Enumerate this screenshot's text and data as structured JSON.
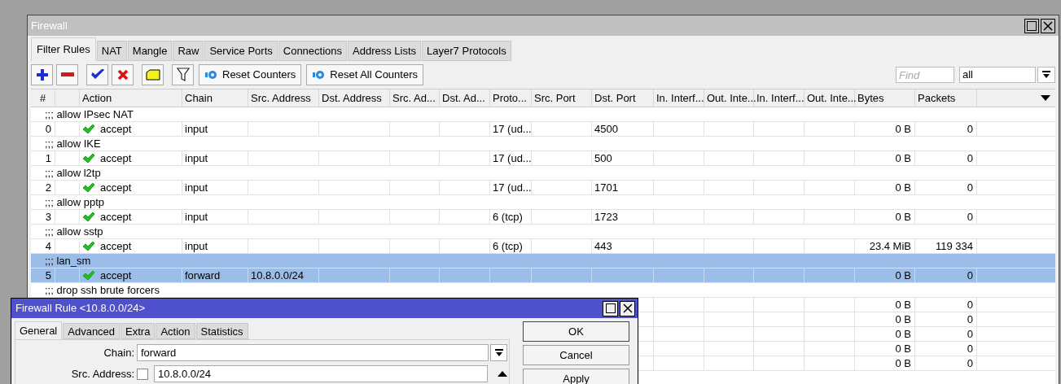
{
  "window": {
    "title": "Firewall"
  },
  "tabs": [
    {
      "label": "Filter Rules",
      "selected": true
    },
    {
      "label": "NAT",
      "selected": false
    },
    {
      "label": "Mangle",
      "selected": false
    },
    {
      "label": "Raw",
      "selected": false
    },
    {
      "label": "Service Ports",
      "selected": false
    },
    {
      "label": "Connections",
      "selected": false
    },
    {
      "label": "Address Lists",
      "selected": false
    },
    {
      "label": "Layer7 Protocols",
      "selected": false
    }
  ],
  "toolbar": {
    "icon_buttons": [
      {
        "kind": "add"
      },
      {
        "kind": "remove"
      },
      {
        "kind": "enable"
      },
      {
        "kind": "disable"
      },
      {
        "kind": "comment"
      },
      {
        "kind": "filter"
      }
    ],
    "text_buttons": [
      "Reset Counters",
      "Reset All Counters"
    ],
    "find": {
      "placeholder": "Find"
    },
    "filter_select": {
      "value": "all"
    }
  },
  "table": {
    "columns": [
      "#",
      "Action",
      "Chain",
      "Src. Address",
      "Dst. Address",
      "Src. Ad...",
      "Dst. Ad...",
      "Proto...",
      "Src. Port",
      "Dst. Port",
      "In. Interf...",
      "Out. Inte...",
      "In. Interf...",
      "Out. Inte...",
      "Bytes",
      "Packets"
    ],
    "rows": [
      {
        "kind": "comment",
        "text": ";;; allow IPsec NAT",
        "selected": false
      },
      {
        "kind": "rule",
        "number": "0",
        "action": "accept",
        "chain": "input",
        "protocol": "17 (ud...",
        "dst_port": "4500",
        "bytes": "0 B",
        "packets": "0",
        "selected": false
      },
      {
        "kind": "comment",
        "text": ";;; allow IKE",
        "selected": false
      },
      {
        "kind": "rule",
        "number": "1",
        "action": "accept",
        "chain": "input",
        "protocol": "17 (ud...",
        "dst_port": "500",
        "bytes": "0 B",
        "packets": "0",
        "selected": false
      },
      {
        "kind": "comment",
        "text": ";;; allow l2tp",
        "selected": false
      },
      {
        "kind": "rule",
        "number": "2",
        "action": "accept",
        "chain": "input",
        "protocol": "17 (ud...",
        "dst_port": "1701",
        "bytes": "0 B",
        "packets": "0",
        "selected": false
      },
      {
        "kind": "comment",
        "text": ";;; allow pptp",
        "selected": false
      },
      {
        "kind": "rule",
        "number": "3",
        "action": "accept",
        "chain": "input",
        "protocol": "6 (tcp)",
        "dst_port": "1723",
        "bytes": "0 B",
        "packets": "0",
        "selected": false
      },
      {
        "kind": "comment",
        "text": ";;; allow sstp",
        "selected": false
      },
      {
        "kind": "rule",
        "number": "4",
        "action": "accept",
        "chain": "input",
        "protocol": "6 (tcp)",
        "dst_port": "443",
        "bytes": "23.4 MiB",
        "packets": "119 334",
        "selected": false
      },
      {
        "kind": "comment",
        "text": ";;; lan_sm",
        "selected": true
      },
      {
        "kind": "rule",
        "number": "5",
        "action": "accept",
        "chain": "forward",
        "src_address": "10.8.0.0/24",
        "bytes": "0 B",
        "packets": "0",
        "selected": true
      },
      {
        "kind": "comment",
        "text": ";;; drop ssh brute forcers",
        "selected": false
      },
      {
        "kind": "rule",
        "bytes": "0 B",
        "packets": "0",
        "selected": false
      },
      {
        "kind": "rule",
        "bytes": "0 B",
        "packets": "0",
        "selected": false
      },
      {
        "kind": "rule",
        "bytes": "0 B",
        "packets": "0",
        "selected": false
      },
      {
        "kind": "rule",
        "bytes": "0 B",
        "packets": "0",
        "selected": false
      },
      {
        "kind": "rule",
        "bytes": "0 B",
        "packets": "0",
        "selected": false
      }
    ]
  },
  "dialog": {
    "title": "Firewall Rule <10.8.0.0/24>",
    "tabs": [
      {
        "label": "General",
        "selected": true
      },
      {
        "label": "Advanced",
        "selected": false
      },
      {
        "label": "Extra",
        "selected": false
      },
      {
        "label": "Action",
        "selected": false
      },
      {
        "label": "Statistics",
        "selected": false
      }
    ],
    "fields": [
      {
        "kind": "select",
        "label": "Chain:",
        "value": "forward"
      },
      {
        "kind": "address",
        "label": "Src. Address:",
        "negated": false,
        "value": "10.8.0.0/24"
      }
    ],
    "buttons": [
      "OK",
      "Cancel",
      "Apply"
    ]
  }
}
